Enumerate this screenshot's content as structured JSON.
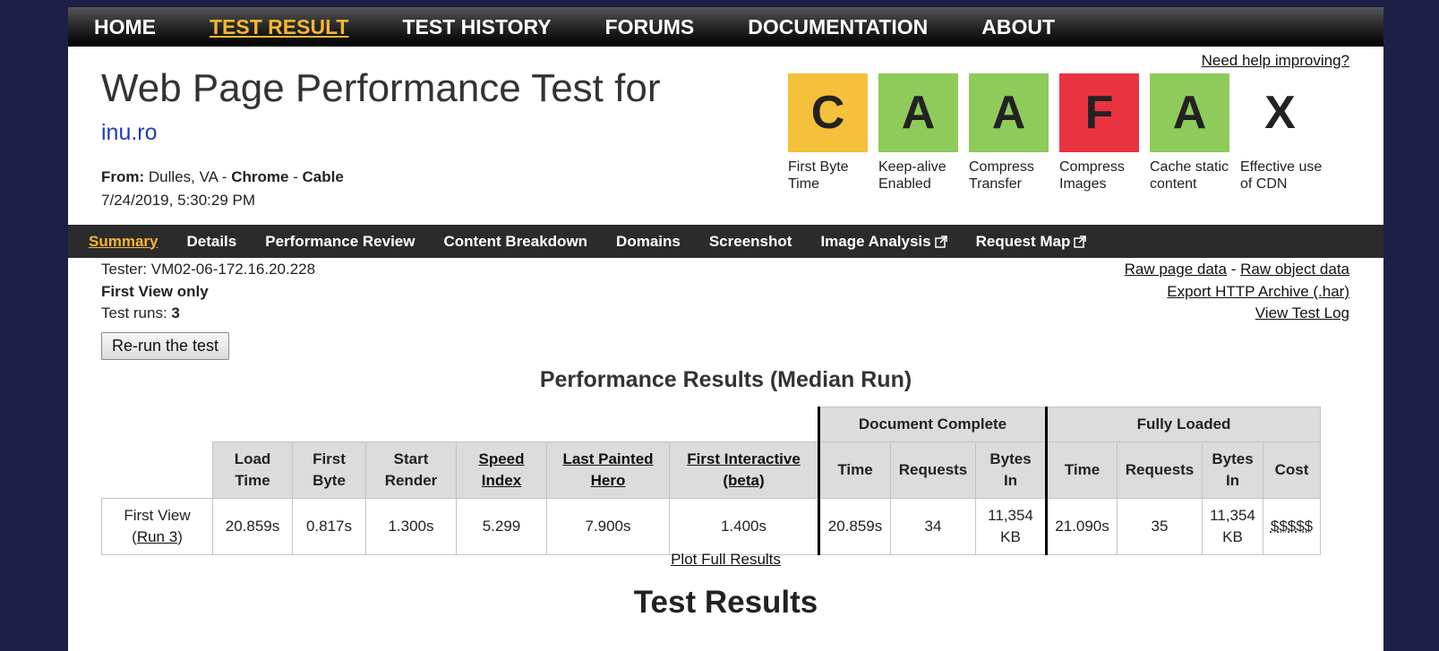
{
  "topnav": {
    "items": [
      {
        "label": "HOME",
        "active": false
      },
      {
        "label": "TEST RESULT",
        "active": true
      },
      {
        "label": "TEST HISTORY",
        "active": false
      },
      {
        "label": "FORUMS",
        "active": false
      },
      {
        "label": "DOCUMENTATION",
        "active": false
      },
      {
        "label": "ABOUT",
        "active": false
      }
    ]
  },
  "header": {
    "title": "Web Page Performance Test for",
    "url": "inu.ro",
    "from_label": "From:",
    "location": "Dulles, VA",
    "separator": " - ",
    "browser": "Chrome",
    "connection": "Cable",
    "datetime": "7/24/2019, 5:30:29 PM",
    "help_link": "Need help improving?"
  },
  "grades": [
    {
      "letter": "C",
      "label": "First Byte Time",
      "color": "#f5c03b"
    },
    {
      "letter": "A",
      "label": "Keep-alive Enabled",
      "color": "#8fcb5b"
    },
    {
      "letter": "A",
      "label": "Compress Transfer",
      "color": "#8fcb5b"
    },
    {
      "letter": "F",
      "label": "Compress Images",
      "color": "#e93340"
    },
    {
      "letter": "A",
      "label": "Cache static content",
      "color": "#8fcb5b"
    },
    {
      "letter": "X",
      "label": "Effective use of CDN",
      "color": "#ffffff"
    }
  ],
  "subnav": {
    "items": [
      {
        "label": "Summary",
        "active": true,
        "external": false
      },
      {
        "label": "Details",
        "active": false,
        "external": false
      },
      {
        "label": "Performance Review",
        "active": false,
        "external": false
      },
      {
        "label": "Content Breakdown",
        "active": false,
        "external": false
      },
      {
        "label": "Domains",
        "active": false,
        "external": false
      },
      {
        "label": "Screenshot",
        "active": false,
        "external": false
      },
      {
        "label": "Image Analysis",
        "active": false,
        "external": true
      },
      {
        "label": "Request Map",
        "active": false,
        "external": true
      }
    ]
  },
  "info": {
    "tester": "Tester: VM02-06-172.16.20.228",
    "view": "First View only",
    "runs_label": "Test runs: ",
    "runs_value": "3",
    "rerun_button": "Re-run the test",
    "raw_page_data": "Raw page data",
    "dash": " - ",
    "raw_object_data": "Raw object data",
    "export_har": "Export HTTP Archive (.har)",
    "view_log": "View Test Log"
  },
  "results": {
    "heading": "Performance Results (Median Run)",
    "group_document": "Document Complete",
    "group_fully": "Fully Loaded",
    "col_load_time_1": "Load",
    "col_load_time_2": "Time",
    "col_first_byte_1": "First",
    "col_first_byte_2": "Byte",
    "col_start_render_1": "Start",
    "col_start_render_2": "Render",
    "col_speed_index_1": "Speed",
    "col_speed_index_2": "Index",
    "col_lph_1": "Last Painted",
    "col_lph_2": "Hero",
    "col_fi_1": "First Interactive",
    "col_fi_2": "(beta)",
    "col_time": "Time",
    "col_requests": "Requests",
    "col_bytes_1": "Bytes",
    "col_bytes_2": "In",
    "col_cost": "Cost",
    "row_label": "First View",
    "row_run_open": "(",
    "row_run_link": "Run 3",
    "row_run_close": ")",
    "load_time": "20.859s",
    "first_byte": "0.817s",
    "start_render": "1.300s",
    "speed_index": "5.299",
    "last_painted_hero": "7.900s",
    "first_interactive": "1.400s",
    "doc_time": "20.859s",
    "doc_requests": "34",
    "doc_bytes_1": "11,354",
    "doc_bytes_2": "KB",
    "full_time": "21.090s",
    "full_requests": "35",
    "full_bytes_1": "11,354",
    "full_bytes_2": "KB",
    "cost": "$$$$$"
  },
  "plot_link": "Plot Full Results",
  "test_results_heading": "Test Results"
}
